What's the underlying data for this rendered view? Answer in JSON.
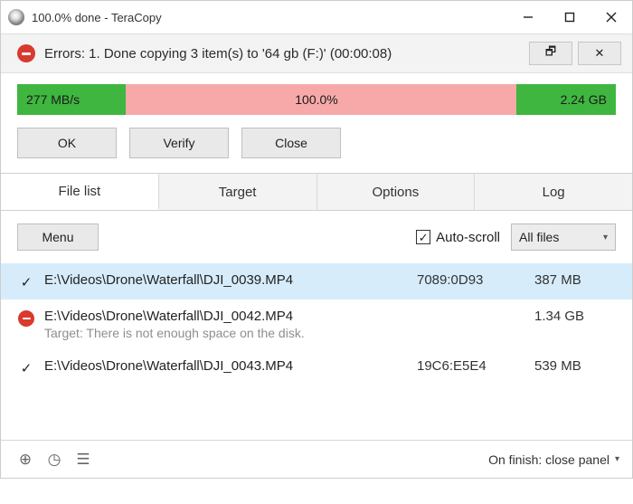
{
  "titlebar": {
    "title": "100.0% done - TeraCopy"
  },
  "status": {
    "message": "Errors: 1. Done copying 3 item(s) to '64 gb (F:)' (00:00:08)",
    "lockGlyph": "🗗",
    "closeGlyph": "✕"
  },
  "progress": {
    "speed": "277 MB/s",
    "percent": "100.0%",
    "total": "2.24 GB"
  },
  "buttons": {
    "ok": "OK",
    "verify": "Verify",
    "close": "Close"
  },
  "tabs": {
    "filelist": "File list",
    "target": "Target",
    "options": "Options",
    "log": "Log"
  },
  "toolbar": {
    "menu": "Menu",
    "autoscroll": "Auto-scroll",
    "filter": "All files"
  },
  "files": [
    {
      "path": "E:\\Videos\\Drone\\Waterfall\\DJI_0039.MP4",
      "hash": "7089:0D93",
      "size": "387 MB",
      "status": "ok"
    },
    {
      "path": "E:\\Videos\\Drone\\Waterfall\\DJI_0042.MP4",
      "hash": "",
      "size": "1.34 GB",
      "status": "error",
      "error": "Target: There is not enough space on the disk."
    },
    {
      "path": "E:\\Videos\\Drone\\Waterfall\\DJI_0043.MP4",
      "hash": "19C6:E5E4",
      "size": "539 MB",
      "status": "ok"
    }
  ],
  "footer": {
    "onfinish": "On finish: close panel"
  }
}
